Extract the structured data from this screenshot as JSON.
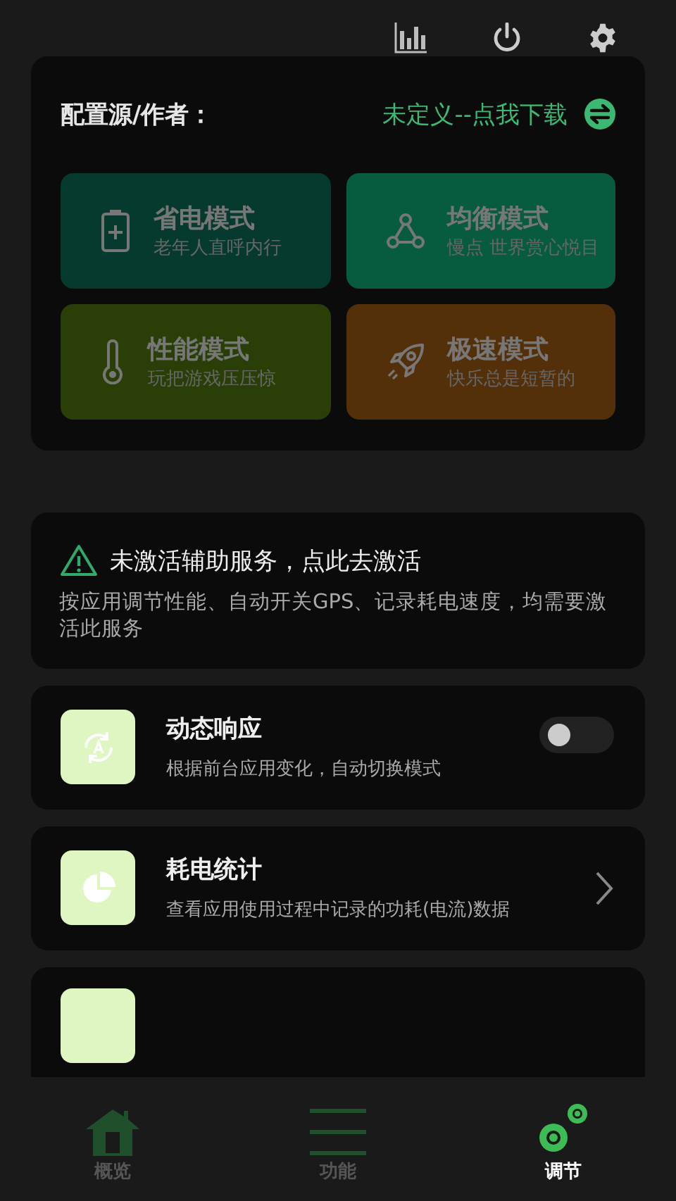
{
  "toolbar": {
    "buttons": [
      {
        "kind": "chart"
      },
      {
        "kind": "power"
      },
      {
        "kind": "settings"
      }
    ]
  },
  "config": {
    "label": "配置源/作者：",
    "link": "未定义--点我下载",
    "modes": [
      {
        "kind": "battery",
        "title": "省电模式",
        "subtitle": "老年人直呼内行",
        "color": "#063a2e"
      },
      {
        "kind": "balance",
        "title": "均衡模式",
        "subtitle": "慢点 世界赏心悦目",
        "color": "#075c3f"
      },
      {
        "kind": "thermometer",
        "title": "性能模式",
        "subtitle": "玩把游戏压压惊",
        "color": "#2a3f08"
      },
      {
        "kind": "rocket",
        "title": "极速模式",
        "subtitle": "快乐总是短暂的",
        "color": "#53300a"
      }
    ]
  },
  "notice": {
    "title": "未激活辅助服务，点此去激活",
    "text": "按应用调节性能、自动开关GPS、记录耗电速度，均需要激活此服务"
  },
  "features": [
    {
      "kind": "toggle",
      "title": "动态响应",
      "text": "根据前台应用变化，自动切换模式",
      "on": false
    },
    {
      "kind": "link",
      "title": "耗电统计",
      "text": "查看应用使用过程中记录的功耗(电流)数据"
    },
    {
      "kind": "partial"
    }
  ],
  "nav": [
    {
      "kind": "home",
      "label": "概览",
      "selected": false
    },
    {
      "kind": "menu",
      "label": "功能",
      "selected": false
    },
    {
      "kind": "gears",
      "label": "调节",
      "selected": true
    }
  ]
}
